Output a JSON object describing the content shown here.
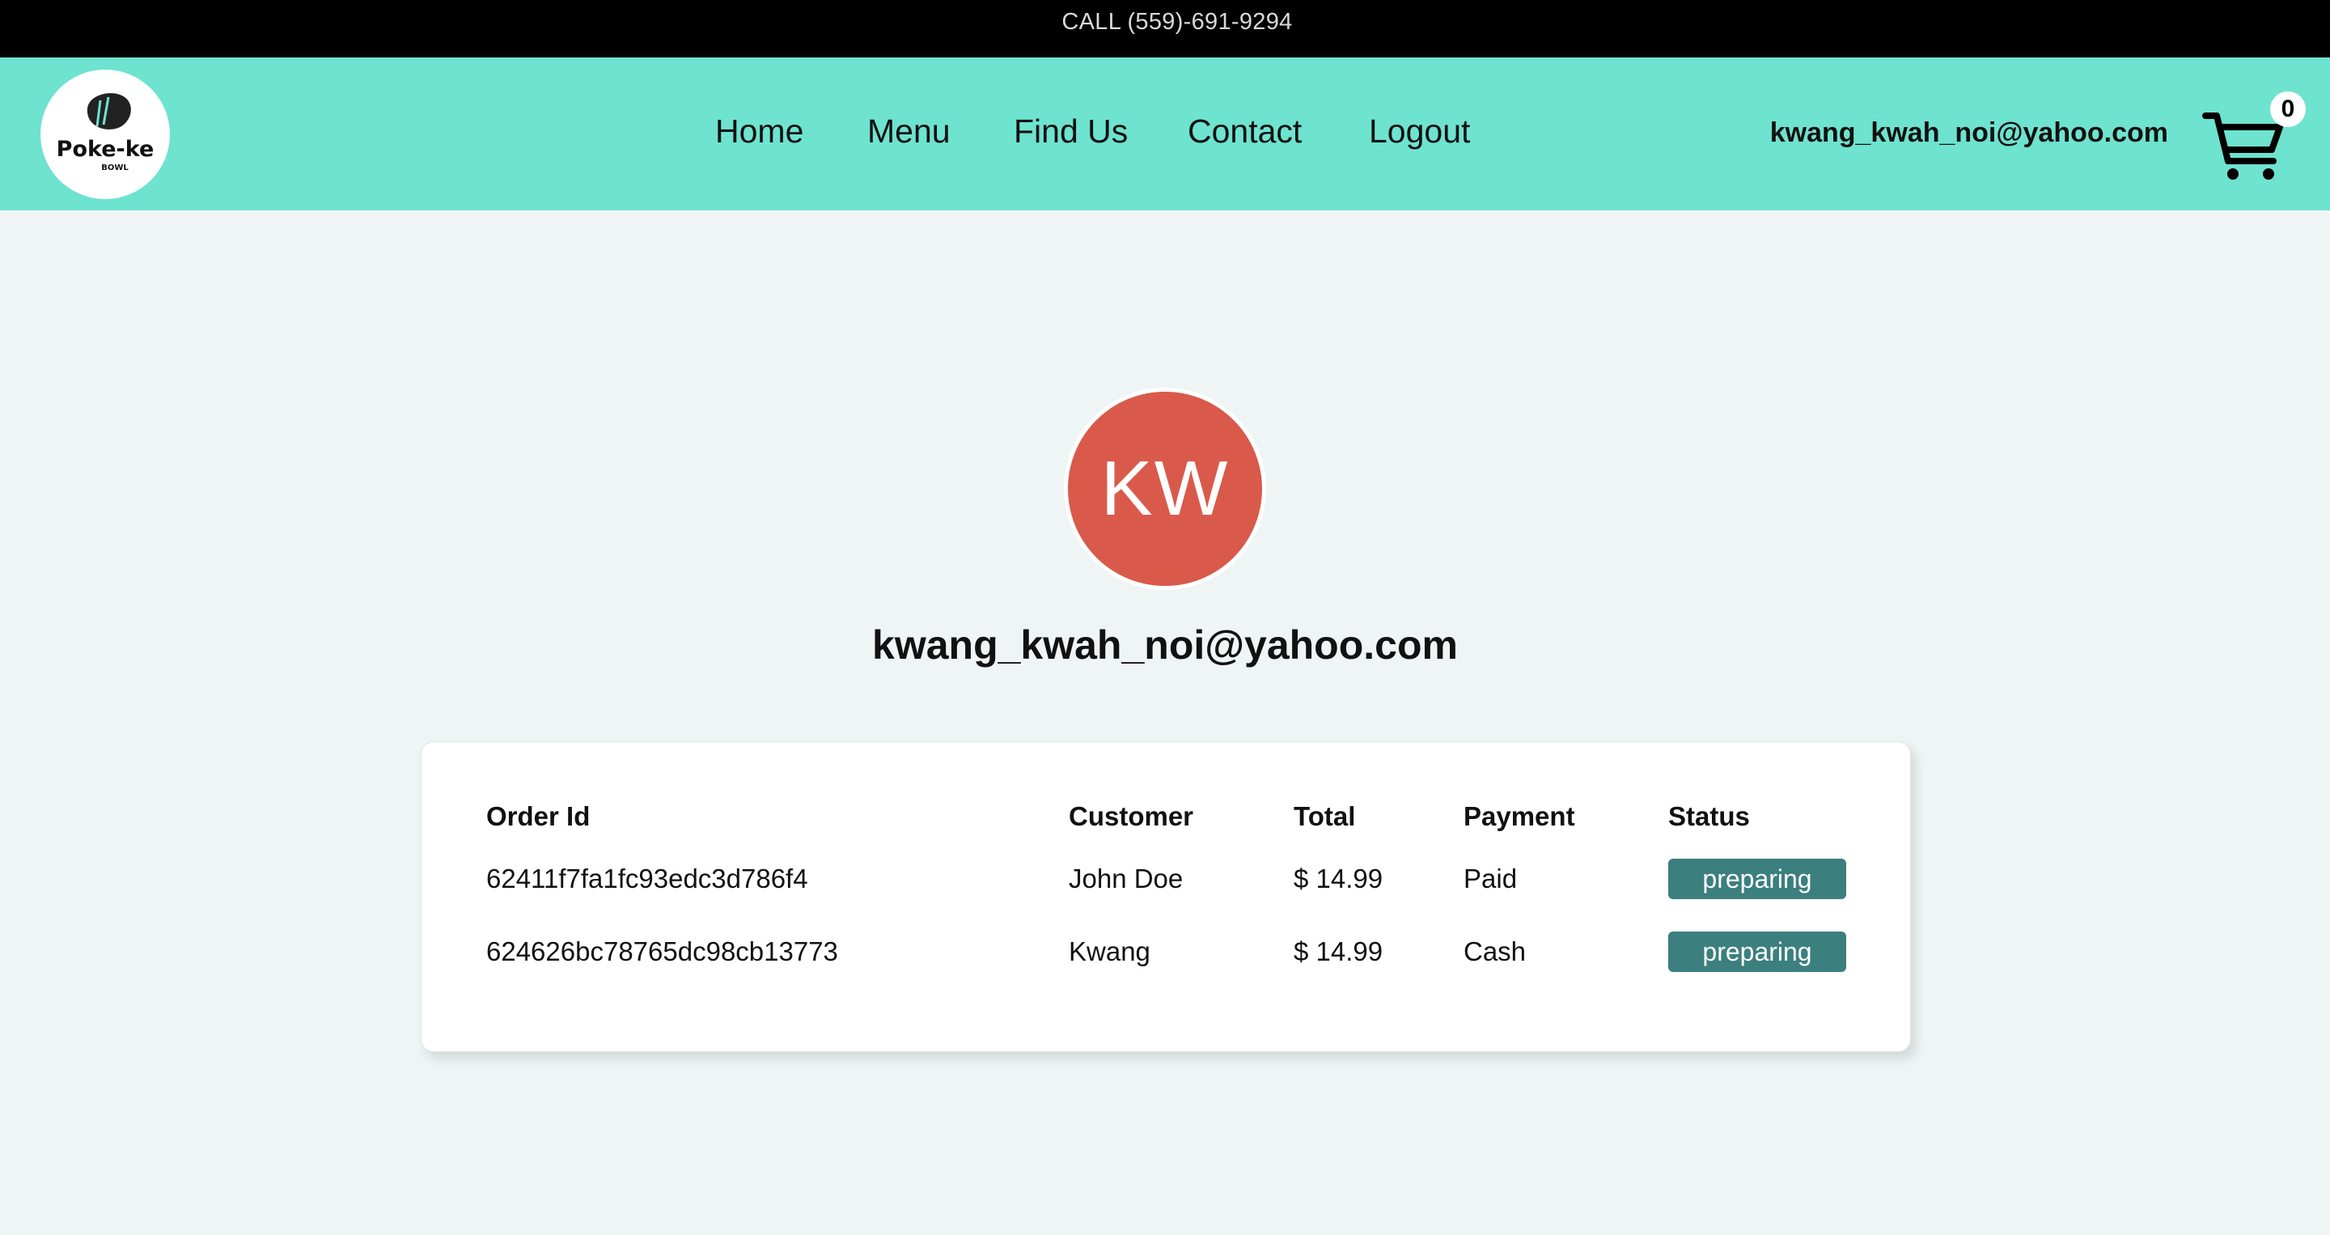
{
  "topbar": {
    "phone_text": "CALL (559)-691-9294"
  },
  "navbar": {
    "logo": {
      "text": "Poke-ke",
      "subtext": "BOWL"
    },
    "links": [
      {
        "label": "Home"
      },
      {
        "label": "Menu"
      },
      {
        "label": "Find Us"
      },
      {
        "label": "Contact"
      },
      {
        "label": "Logout"
      }
    ],
    "user_email": "kwang_kwah_noi@yahoo.com",
    "cart": {
      "icon": "cart-icon",
      "count": "0"
    }
  },
  "profile": {
    "initials": "KW",
    "email": "kwang_kwah_noi@yahoo.com",
    "avatar_color": "#d95a4a"
  },
  "orders": {
    "columns": [
      "Order Id",
      "Customer",
      "Total",
      "Payment",
      "Status"
    ],
    "rows": [
      {
        "order_id": "62411f7fa1fc93edc3d786f4",
        "customer": "John Doe",
        "total": "$ 14.99",
        "payment": "Paid",
        "status": "preparing"
      },
      {
        "order_id": "624626bc78765dc98cb13773",
        "customer": "Kwang",
        "total": "$ 14.99",
        "payment": "Cash",
        "status": "preparing"
      }
    ]
  },
  "colors": {
    "navbar_bg": "#6ee3cf",
    "topbar_bg": "#000000",
    "page_bg": "#eff5f4",
    "status_badge": "#3b7f7e"
  }
}
